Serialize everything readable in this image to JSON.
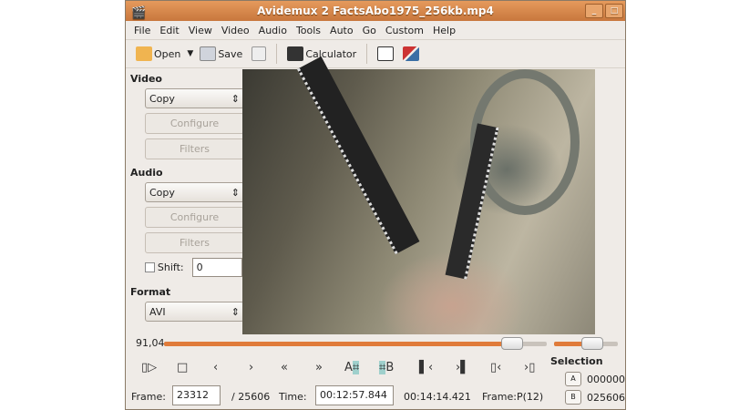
{
  "window": {
    "title": "Avidemux 2 FactsAbo1975_256kb.mp4",
    "minimize": "_",
    "maximize": "□"
  },
  "menu": [
    "File",
    "Edit",
    "View",
    "Video",
    "Audio",
    "Tools",
    "Auto",
    "Go",
    "Custom",
    "Help"
  ],
  "toolbar": {
    "open": "Open",
    "save": "Save",
    "calculator": "Calculator"
  },
  "video": {
    "heading": "Video",
    "codec": "Copy",
    "configure": "Configure",
    "filters": "Filters"
  },
  "audio": {
    "heading": "Audio",
    "codec": "Copy",
    "configure": "Configure",
    "filters": "Filters",
    "shift_label": "Shift:",
    "shift_value": "0"
  },
  "format": {
    "heading": "Format",
    "value": "AVI"
  },
  "seek": {
    "position_label": "91,04",
    "position_percent": 91.04,
    "volume_percent": 60
  },
  "controls": {
    "mark_a": "A",
    "mark_b": "B"
  },
  "status": {
    "frame_label": "Frame:",
    "frame_value": "23312",
    "total_frames": "/ 25606",
    "time_label": "Time:",
    "time_value": "00:12:57.844",
    "duration": "00:14:14.421",
    "frame_type": "Frame:P(12)"
  },
  "selection": {
    "heading": "Selection",
    "a_label": "A",
    "a_value": "000000",
    "b_label": "B",
    "b_value": "025606"
  }
}
